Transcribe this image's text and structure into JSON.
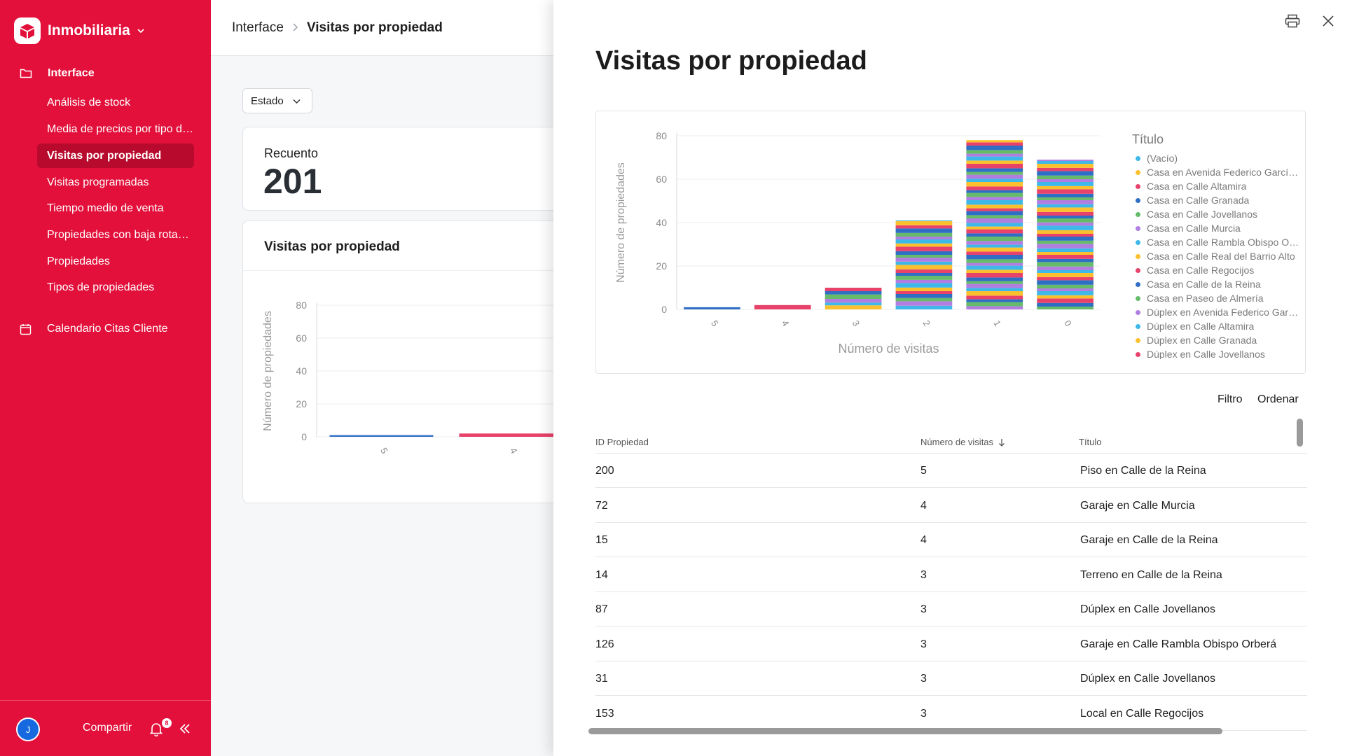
{
  "sidebar": {
    "brand": "Inmobiliaria",
    "section_interface": "Interface",
    "items": [
      {
        "label": "Análisis de stock"
      },
      {
        "label": "Media de precios por tipo de propiedad"
      },
      {
        "label": "Visitas por propiedad",
        "active": true
      },
      {
        "label": "Visitas programadas"
      },
      {
        "label": "Tiempo medio de venta"
      },
      {
        "label": "Propiedades con baja rotación"
      },
      {
        "label": "Propiedades"
      },
      {
        "label": "Tipos de propiedades"
      }
    ],
    "section_calendar": "Calendario Citas Cliente",
    "footer": {
      "avatar_initial": "J",
      "share_label": "Compartir",
      "notification_count": "8"
    },
    "color": "#e2103a"
  },
  "page": {
    "breadcrumb_root": "Interface",
    "breadcrumb_sep": ">",
    "breadcrumb_current": "Visitas por propiedad",
    "filter_label": "Estado",
    "count_card": {
      "label": "Recuento",
      "value": "201"
    },
    "chart_card": {
      "title": "Visitas por propiedad"
    }
  },
  "panel": {
    "title": "Visitas por propiedad",
    "filter_label": "Filtro",
    "sort_label": "Ordenar",
    "table": {
      "columns": [
        "ID Propiedad",
        "Número de visitas",
        "Título"
      ],
      "sort_icon": "arrow-down",
      "rows": [
        [
          "200",
          "5",
          "Piso en Calle de la Reina"
        ],
        [
          "72",
          "4",
          "Garaje en Calle Murcia"
        ],
        [
          "15",
          "4",
          "Garaje en Calle de la Reina"
        ],
        [
          "14",
          "3",
          "Terreno en Calle de la Reina"
        ],
        [
          "87",
          "3",
          "Dúplex en Calle Jovellanos"
        ],
        [
          "126",
          "3",
          "Garaje en Calle Rambla Obispo Orberá"
        ],
        [
          "31",
          "3",
          "Dúplex en Calle Jovellanos"
        ],
        [
          "153",
          "3",
          "Local en Calle Regocijos"
        ]
      ]
    }
  },
  "chart_data": {
    "type": "bar",
    "stacked": true,
    "xlabel": "Número de visitas",
    "ylabel": "Número de propiedades",
    "categories": [
      "5",
      "4",
      "3",
      "2",
      "1",
      "0"
    ],
    "values": [
      1,
      2,
      10,
      41,
      78,
      69
    ],
    "ylim": [
      0,
      80
    ],
    "yticks": [
      "0",
      "20",
      "40",
      "60",
      "80"
    ],
    "grid": true,
    "legend_title": "Título",
    "legend_position": "right",
    "legend": [
      {
        "label": "(Vacío)",
        "color": "#3db8e8"
      },
      {
        "label": "Casa en Avenida Federico García Lorca",
        "color": "#fbc02d"
      },
      {
        "label": "Casa en Calle Altamira",
        "color": "#e8416a"
      },
      {
        "label": "Casa en Calle Granada",
        "color": "#2f6ec5"
      },
      {
        "label": "Casa en Calle Jovellanos",
        "color": "#66bb6a"
      },
      {
        "label": "Casa en Calle Murcia",
        "color": "#b07ee0"
      },
      {
        "label": "Casa en Calle Rambla Obispo Orberá",
        "color": "#3db8e8"
      },
      {
        "label": "Casa en Calle Real del Barrio Alto",
        "color": "#fbc02d"
      },
      {
        "label": "Casa en Calle Regocijos",
        "color": "#e8416a"
      },
      {
        "label": "Casa en Calle de la Reina",
        "color": "#2f6ec5"
      },
      {
        "label": "Casa en Paseo de Almería",
        "color": "#66bb6a"
      },
      {
        "label": "Dúplex en Avenida Federico García Lorca",
        "color": "#b07ee0"
      },
      {
        "label": "Dúplex en Calle Altamira",
        "color": "#3db8e8"
      },
      {
        "label": "Dúplex en Calle Granada",
        "color": "#fbc02d"
      },
      {
        "label": "Dúplex en Calle Jovellanos",
        "color": "#e8416a"
      }
    ],
    "palette": [
      "#3db8e8",
      "#fbc02d",
      "#e8416a",
      "#2f6ec5",
      "#66bb6a",
      "#b07ee0"
    ]
  }
}
